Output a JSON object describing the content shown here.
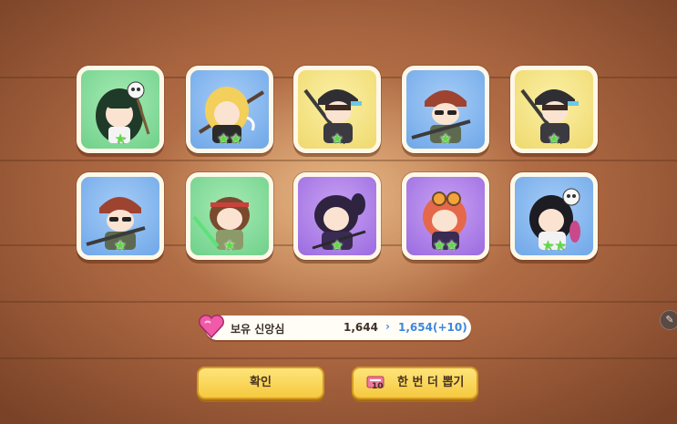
{
  "results": {
    "characters": [
      {
        "frame": "green",
        "stars": "★",
        "portrait": "hooded-girl-with-skull"
      },
      {
        "frame": "blue",
        "stars": "★★",
        "portrait": "blonde-girl-with-rifle"
      },
      {
        "frame": "yellow",
        "stars": "★",
        "portrait": "helmet-soldier-rifle"
      },
      {
        "frame": "blue",
        "stars": "★",
        "portrait": "helmet-soldier-sunglasses"
      },
      {
        "frame": "yellow",
        "stars": "★",
        "portrait": "helmet-soldier-rifle"
      },
      {
        "frame": "blue",
        "stars": "★",
        "portrait": "helmet-soldier-sunglasses"
      },
      {
        "frame": "green",
        "stars": "★",
        "portrait": "headband-girl-blade"
      },
      {
        "frame": "purple",
        "stars": "★",
        "portrait": "dark-hair-girl"
      },
      {
        "frame": "purple",
        "stars": "★★",
        "portrait": "goggles-girl-red-hair"
      },
      {
        "frame": "blue",
        "stars": "★★",
        "portrait": "skull-mask-girl"
      }
    ]
  },
  "currency_bar": {
    "label": "보유 신앙심",
    "current": "1,644",
    "arrow": "›",
    "next": "1,654(+10)",
    "icon": "pink-heart-gem-icon"
  },
  "buttons": {
    "confirm": "확인",
    "again": "한 번 더 뽑기",
    "ticket_count": "10",
    "ticket_icon": "summon-ticket-icon"
  },
  "edit_icon": "pencil-icon",
  "colors": {
    "green": "#6fd08a",
    "blue": "#6fa7e8",
    "yellow": "#efd96d",
    "purple": "#9b6be0",
    "button": "#f6c93f",
    "star": "#5dd944"
  }
}
